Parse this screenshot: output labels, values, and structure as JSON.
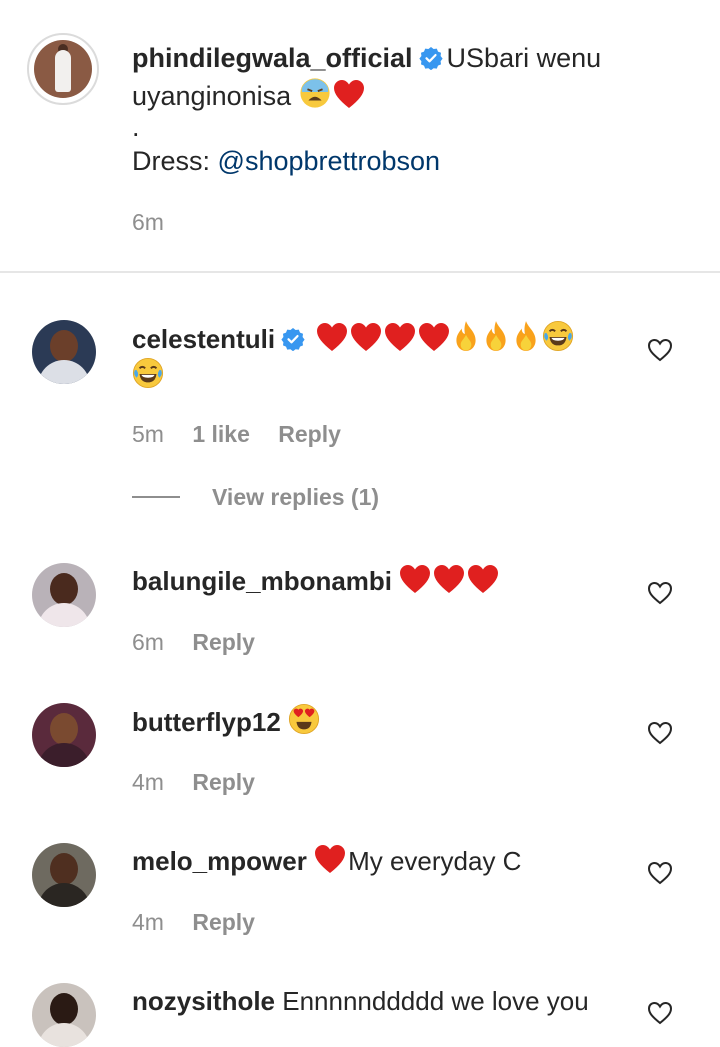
{
  "caption": {
    "username": "phindilegwala_official",
    "text_line1": "USbari wenu",
    "text_line2": "uyanginonisa",
    "dot": ".",
    "dress_label": "Dress:",
    "dress_mention": "@shopbrettrobson",
    "time": "6m"
  },
  "comments": [
    {
      "username": "celestentuli",
      "verified": true,
      "text": "",
      "time": "5m",
      "likes": "1 like",
      "reply": "Reply",
      "view_replies": "View replies (1)"
    },
    {
      "username": "balungile_mbonambi",
      "verified": false,
      "text": "",
      "time": "6m",
      "reply": "Reply"
    },
    {
      "username": "butterflyp12",
      "verified": false,
      "text": "",
      "time": "4m",
      "reply": "Reply"
    },
    {
      "username": "melo_mpower",
      "verified": false,
      "text": "My everyday C",
      "time": "4m",
      "reply": "Reply"
    },
    {
      "username": "nozysithole",
      "verified": false,
      "text": "Ennnnnddddd we love you",
      "time": "",
      "reply": ""
    }
  ],
  "colors": {
    "link": "#00376b",
    "muted": "#8e8e8e",
    "verified": "#3897f0",
    "heart": "#e0201f"
  }
}
